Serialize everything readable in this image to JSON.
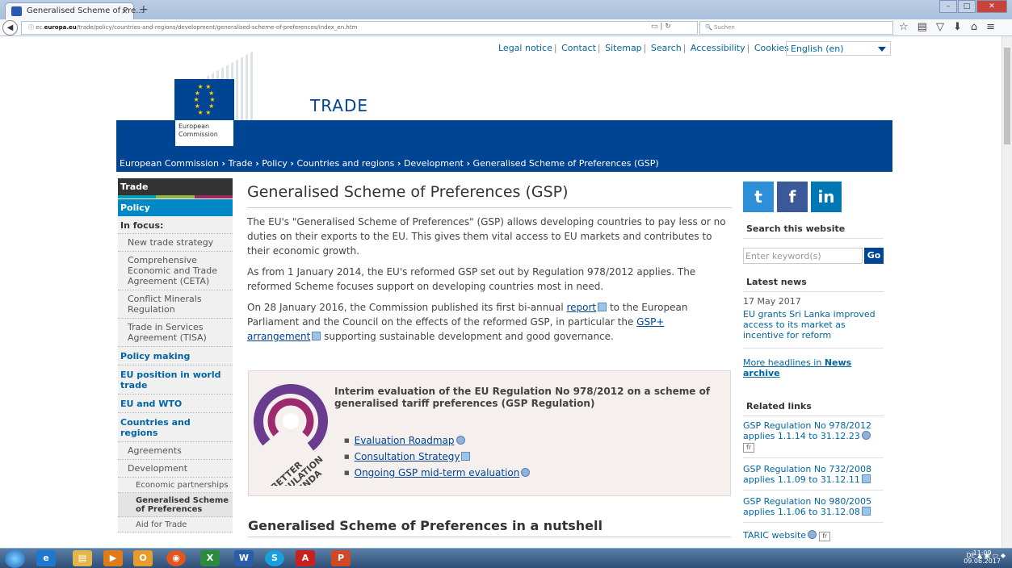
{
  "browser": {
    "tab_title": "Generalised Scheme of Pre...",
    "tab_close": "×",
    "new_tab": "+",
    "url_prefix": "ec.",
    "url_domain": "europa.eu",
    "url_path": "/trade/policy/countries-and-regions/development/generalised-scheme-of-preferences/index_en.htm",
    "search_placeholder": "Suchen",
    "icons": [
      "star-icon",
      "bookmarks-icon",
      "pocket-icon",
      "download-icon",
      "home-icon",
      "menu-icon"
    ]
  },
  "header": {
    "site_title": "TRADE",
    "ec_label_line1": "European",
    "ec_label_line2": "Commission",
    "top_links": [
      "Legal notice",
      "Contact",
      "Sitemap",
      "Search",
      "Accessibility",
      "Cookies"
    ],
    "language": "English (en)"
  },
  "breadcrumb": [
    "European Commission",
    "Trade",
    "Policy",
    "Countries and regions",
    "Development",
    "Generalised Scheme of Preferences (GSP)"
  ],
  "breadcrumb_sep": "›",
  "leftnav": {
    "trade": "Trade",
    "policy": "Policy",
    "in_focus": "In focus:",
    "focus_items": [
      "New trade strategy",
      "Comprehensive Economic and Trade Agreement (CETA)",
      "Conflict Minerals Regulation",
      "Trade in Services Agreement (TISA)"
    ],
    "policy_making": "Policy making",
    "eu_position": "EU position in world trade",
    "eu_wto": "EU and WTO",
    "countries_regions": "Countries and regions",
    "agreements": "Agreements",
    "development": "Development",
    "economic_partnerships": "Economic partnerships",
    "gsp": "Generalised Scheme of Preferences",
    "aid_for_trade": "Aid for Trade"
  },
  "main": {
    "title": "Generalised Scheme of Preferences (GSP)",
    "p1": "The EU's \"Generalised Scheme of Preferences\" (GSP) allows developing countries to pay less or no duties on their exports to the EU. This gives them vital access to EU markets and contributes to their economic growth.",
    "p2": "As from 1 January 2014, the EU's reformed GSP set out by Regulation 978/2012 applies. The reformed Scheme focuses support on developing countries most in need.",
    "p3_a": "On 28 January 2016, the Commission published its first bi-annual ",
    "p3_report": "report",
    "p3_b": " to the European Parliament and the Council on the effects of the reformed GSP, in particular the ",
    "p3_link": "GSP+ arrangement",
    "p3_c": " supporting sustainable development and good governance.",
    "eval_title": "Interim evaluation of the EU Regulation No 978/2012 on a scheme of generalised tariff preferences (GSP Regulation)",
    "eval_logo_text": "BETTER REGULATION AGENDA",
    "eval_links": [
      "Evaluation Roadmap",
      "Consultation Strategy",
      "Ongoing GSP mid-term evaluation"
    ],
    "h2": "Generalised Scheme of Preferences in a nutshell"
  },
  "right": {
    "social": [
      "t",
      "f",
      "in"
    ],
    "search_heading": "Search this website",
    "search_placeholder": "Enter keyword(s)",
    "go": "Go",
    "latest_news": "Latest news",
    "news_date": "17 May 2017",
    "news_item": "EU grants Sri Lanka improved access to its market as incentive for reform",
    "more_headlines_a": "More headlines in ",
    "more_headlines_b": "News archive",
    "related_links": "Related links",
    "links": [
      "GSP Regulation No 978/2012 applies 1.1.14 to 31.12.23",
      "GSP Regulation No 732/2008 applies 1.1.09 to 31.12.11",
      "GSP Regulation No 980/2005 applies 1.1.06 to 31.12.08",
      "TARIC website"
    ],
    "fr": "fr"
  },
  "taskbar": {
    "apps": [
      "ie",
      "explorer",
      "media",
      "outlook",
      "firefox",
      "excel",
      "word",
      "skype",
      "acrobat",
      "powerpoint"
    ],
    "locale": "DE",
    "time": "11:09",
    "date": "09.06.2017"
  },
  "colors": {
    "ec_blue": "#004494",
    "link": "#0065a2",
    "policy": "#0088c6"
  }
}
